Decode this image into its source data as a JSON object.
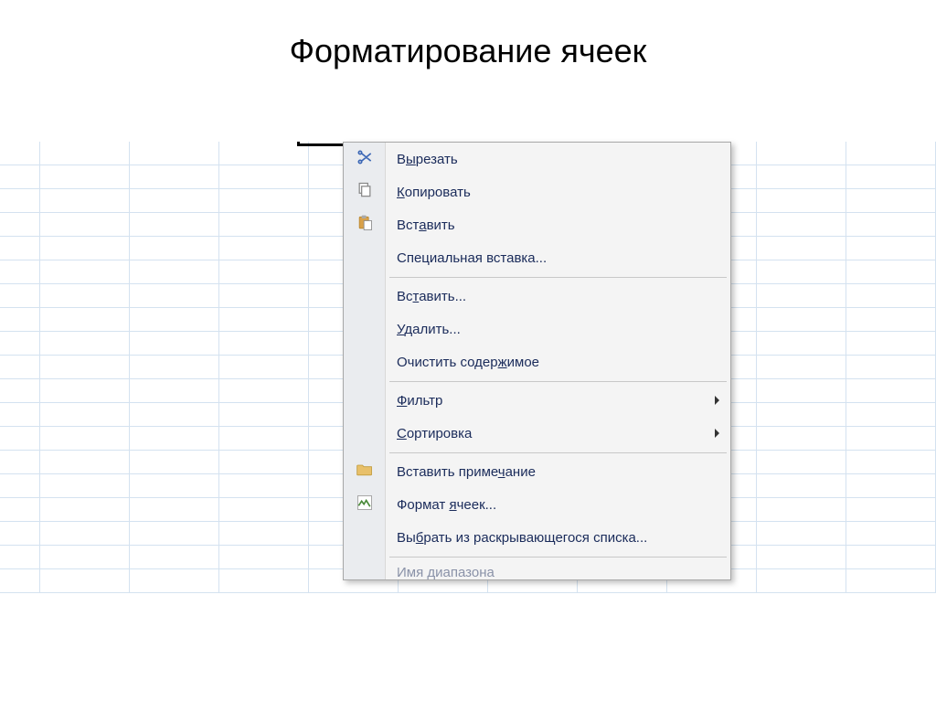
{
  "title": "Форматирование  ячеек",
  "menu": {
    "cut": "Вырезать",
    "copy": "Копировать",
    "paste": "Вставить",
    "paste_special": "Специальная вставка...",
    "insert": "Вставить...",
    "delete": "Удалить...",
    "clear_contents": "Очистить содержимое",
    "filter": "Фильтр",
    "sort": "Сортировка",
    "insert_comment": "Вставить примечание",
    "format_cells": "Формат ячеек...",
    "pick_from_list": "Выбрать из раскрывающегося списка...",
    "name_range": "Имя диапазона"
  }
}
